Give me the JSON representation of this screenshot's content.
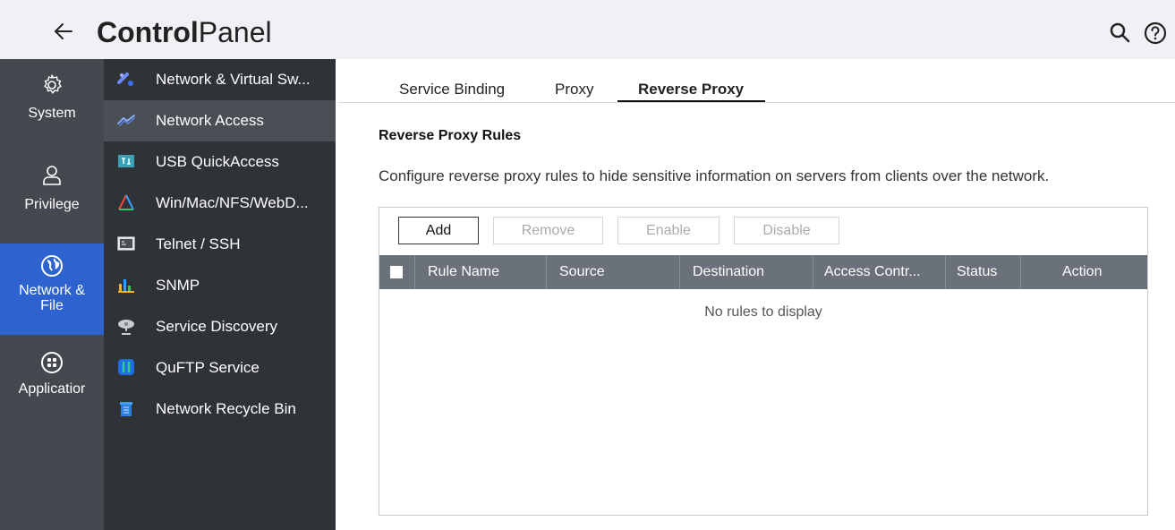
{
  "header": {
    "back_icon": "arrow-left-icon",
    "title_bold": "Control",
    "title_light": "Panel",
    "search_icon": "search-icon",
    "help_icon": "help-icon"
  },
  "rail": [
    {
      "label": "System",
      "icon": "gear-icon",
      "active": false
    },
    {
      "label": "Privilege",
      "icon": "user-icon",
      "active": false
    },
    {
      "label": "Network &",
      "label2": "File",
      "icon": "globe-icon",
      "active": true
    },
    {
      "label": "Applicatior",
      "icon": "apps-grid-icon",
      "active": false
    }
  ],
  "submenu": [
    {
      "label": "Network & Virtual Sw...",
      "icon": "network-switch-icon"
    },
    {
      "label": "Network Access",
      "icon": "network-access-icon",
      "active": true
    },
    {
      "label": "USB QuickAccess",
      "icon": "usb-icon"
    },
    {
      "label": "Win/Mac/NFS/WebD...",
      "icon": "file-services-icon"
    },
    {
      "label": "Telnet / SSH",
      "icon": "terminal-icon"
    },
    {
      "label": "SNMP",
      "icon": "snmp-icon"
    },
    {
      "label": "Service Discovery",
      "icon": "satellite-dish-icon"
    },
    {
      "label": "QuFTP Service",
      "icon": "ftp-icon"
    },
    {
      "label": "Network Recycle Bin",
      "icon": "recycle-bin-icon"
    }
  ],
  "tabs": [
    {
      "label": "Service Binding"
    },
    {
      "label": "Proxy"
    },
    {
      "label": "Reverse Proxy",
      "active": true
    }
  ],
  "section_title": "Reverse Proxy Rules",
  "description": "Configure reverse proxy rules to hide sensitive information on servers from clients over the network.",
  "buttons": {
    "add": "Add",
    "remove": "Remove",
    "enable": "Enable",
    "disable": "Disable"
  },
  "table": {
    "columns": [
      "Rule Name",
      "Source",
      "Destination",
      "Access Contr...",
      "Status",
      "Action"
    ],
    "empty_message": "No rules to display"
  },
  "colors": {
    "accent": "#2e63cf",
    "rail_bg": "#45494f",
    "submenu_bg": "#2f3237",
    "table_header": "#6b717a"
  }
}
